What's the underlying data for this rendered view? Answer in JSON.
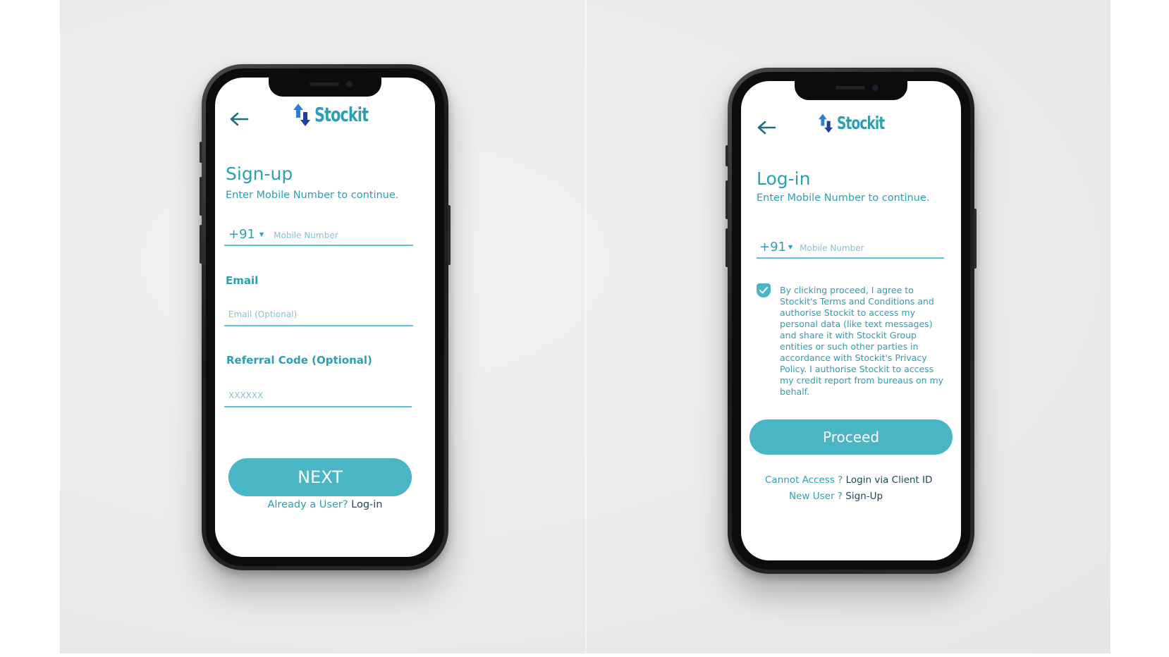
{
  "brand": {
    "name": "Stockit",
    "colors": {
      "teal": "#2b9fb4",
      "button": "#49b5c5",
      "arrow_up": "#2f7fd0",
      "arrow_down": "#1e3f9b"
    }
  },
  "signup": {
    "title": "Sign-up",
    "subtitle": "Enter Mobile Number to continue.",
    "country_code": "+91",
    "mobile_placeholder": "Mobile Number",
    "email_label": "Email",
    "email_placeholder": "Email (Optional)",
    "referral_label": "Referral Code (Optional)",
    "referral_placeholder": "XXXXXX",
    "next_label": "NEXT",
    "already_user_text": "Already a User?",
    "login_link": "Log-in"
  },
  "login": {
    "title": "Log-in",
    "subtitle": "Enter Mobile Number to continue.",
    "country_code": "+91",
    "mobile_placeholder": "Mobile Number",
    "terms_checked": true,
    "terms_text": "By clicking proceed, I agree to Stockit's Terms and Conditions and authorise Stockit to access my personal data (like text messages) and share it with Stockit Group entities or such other parties in accordance with Stockit's Privacy Policy. I authorise Stockit to access my credit report from bureaus on my behalf.",
    "proceed_label": "Proceed",
    "cannot_access_text": "Cannot Access ?",
    "client_id_link": "Login via Client ID",
    "new_user_text": "New User ?",
    "signup_link": "Sign-Up"
  },
  "icons": {
    "back": "arrow-left-icon",
    "logo": "up-down-arrows-icon",
    "caret": "caret-down-icon",
    "check": "check-icon"
  }
}
